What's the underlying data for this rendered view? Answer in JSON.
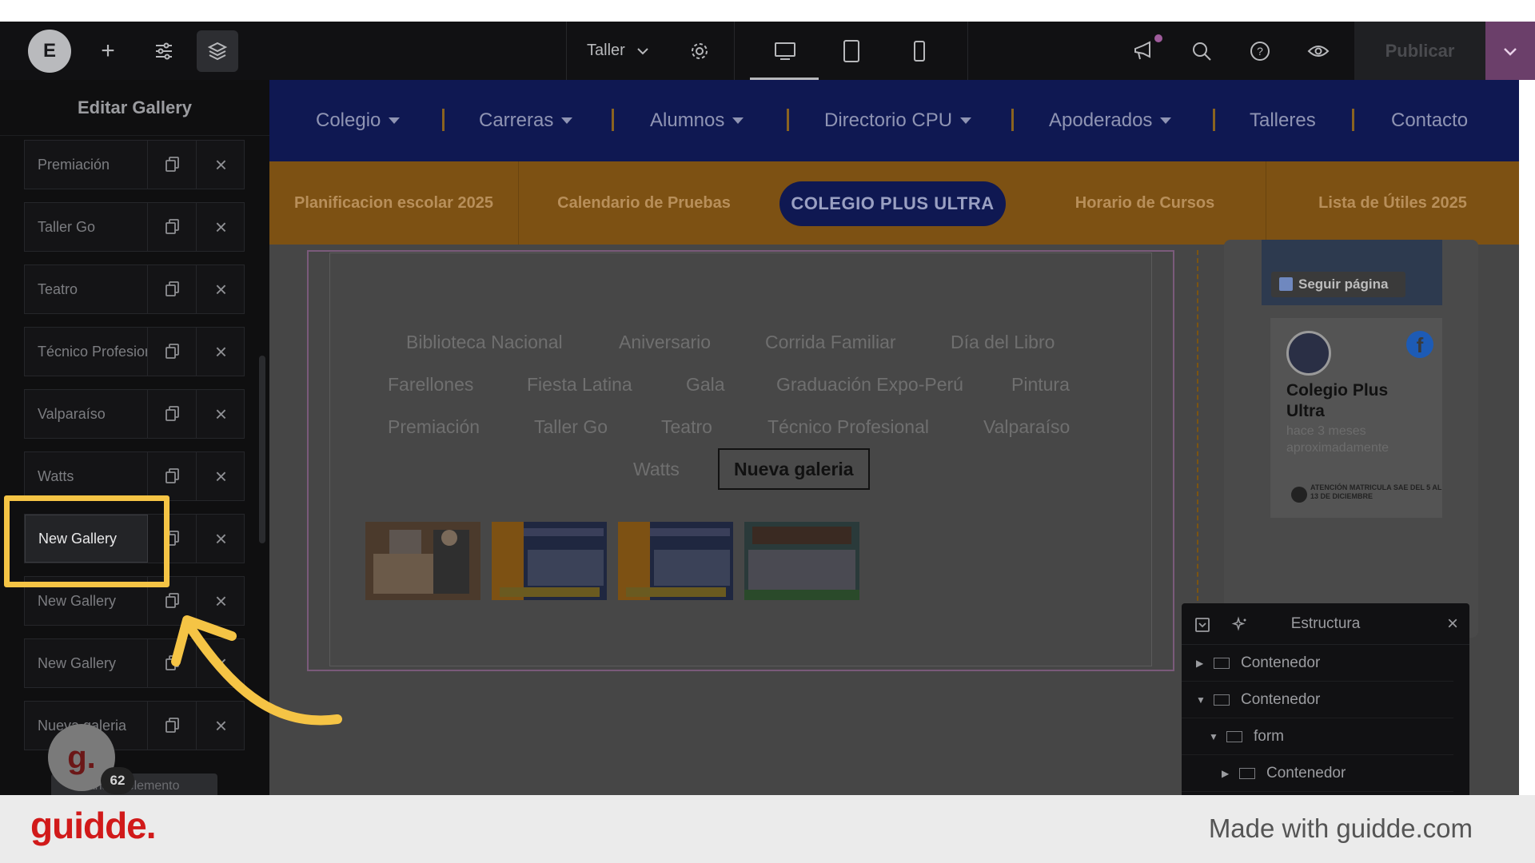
{
  "editor": {
    "page_selector": "Taller",
    "publish_label": "Publicar",
    "panel_title": "Editar Gallery",
    "add_element_label": "Añadir elemento"
  },
  "galleries": [
    {
      "label": "Premiación"
    },
    {
      "label": "Taller Go"
    },
    {
      "label": "Teatro"
    },
    {
      "label": "Técnico Profesional"
    },
    {
      "label": "Valparaíso"
    },
    {
      "label": "Watts"
    },
    {
      "label": "New Gallery"
    },
    {
      "label": "New Gallery"
    },
    {
      "label": "New Gallery"
    },
    {
      "label": "Nueva galeria"
    }
  ],
  "nav": {
    "items": [
      "Colegio",
      "Carreras",
      "Alumnos",
      "Directorio CPU",
      "Apoderados",
      "Talleres",
      "Contacto"
    ]
  },
  "subnav": {
    "items": [
      "Planificacion escolar 2025",
      "Calendario de Pruebas",
      "COLEGIO PLUS ULTRA",
      "Horario de Cursos",
      "Lista de Útiles 2025"
    ]
  },
  "filters": {
    "row1": [
      "Biblioteca Nacional",
      "Aniversario",
      "Corrida Familiar",
      "Día del Libro"
    ],
    "row2": [
      "Farellones",
      "Fiesta Latina",
      "Gala",
      "Graduación Expo-Perú",
      "Pintura"
    ],
    "row3": [
      "Premiación",
      "Taller Go",
      "Teatro",
      "Técnico Profesional",
      "Valparaíso"
    ],
    "row4": [
      "Watts",
      "Nueva galeria"
    ]
  },
  "facebook": {
    "follow_label": "Seguir página",
    "page_name": "Colegio Plus Ultra",
    "time": "hace 3 meses aproximadamente",
    "post_text": "ATENCIÓN MATRICULA SAE DEL 5 AL 13 DE DICIEMBRE"
  },
  "structure": {
    "title": "Estructura",
    "rows": [
      "Contenedor",
      "Contenedor",
      "form",
      "Contenedor"
    ]
  },
  "overlay": {
    "avatar_letter": "g.",
    "badge_count": "62"
  },
  "footer": {
    "brand": "guidde.",
    "made_with": "Made with guidde.com"
  },
  "colors": {
    "nav_bg": "#0f1852",
    "subnav_bg": "#7d5113",
    "highlight": "#f5c445",
    "brand": "#d11a1a"
  }
}
